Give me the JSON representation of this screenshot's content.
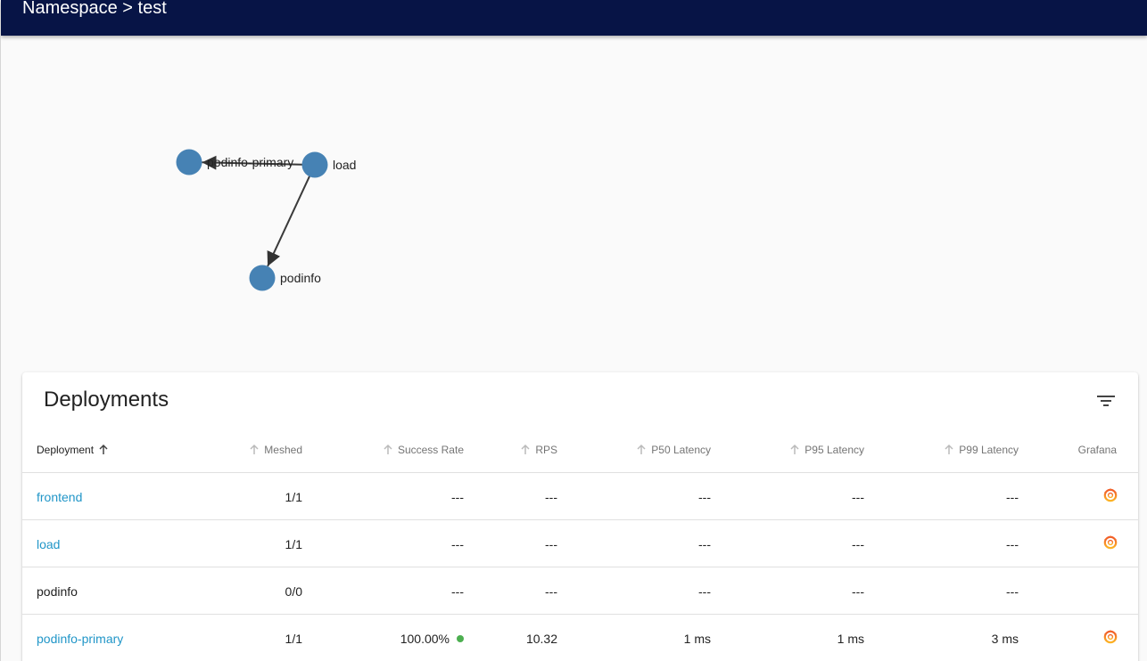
{
  "header": {
    "title": "Namespace > test"
  },
  "graph": {
    "nodes": [
      {
        "id": "podinfo-primary",
        "label": "podinfo-primary"
      },
      {
        "id": "load",
        "label": "load"
      },
      {
        "id": "podinfo",
        "label": "podinfo"
      }
    ],
    "edges": [
      {
        "from": "load",
        "to": "podinfo-primary"
      },
      {
        "from": "load",
        "to": "podinfo"
      }
    ],
    "node_color": "#4682b4"
  },
  "deployments": {
    "title": "Deployments",
    "filter_icon": "filter-list-icon",
    "columns": [
      "Deployment",
      "Meshed",
      "Success Rate",
      "RPS",
      "P50 Latency",
      "P95 Latency",
      "P99 Latency",
      "Grafana"
    ],
    "rows": [
      {
        "name": "frontend",
        "link": true,
        "meshed": "1/1",
        "success": "---",
        "rps": "---",
        "p50": "---",
        "p95": "---",
        "p99": "---",
        "grafana": true
      },
      {
        "name": "load",
        "link": true,
        "meshed": "1/1",
        "success": "---",
        "rps": "---",
        "p50": "---",
        "p95": "---",
        "p99": "---",
        "grafana": true
      },
      {
        "name": "podinfo",
        "link": false,
        "meshed": "0/0",
        "success": "---",
        "rps": "---",
        "p50": "---",
        "p95": "---",
        "p99": "---",
        "grafana": false
      },
      {
        "name": "podinfo-primary",
        "link": true,
        "meshed": "1/1",
        "success": "100.00%",
        "success_status": "good",
        "rps": "10.32",
        "p50": "1 ms",
        "p95": "1 ms",
        "p99": "3 ms",
        "grafana": true
      }
    ]
  },
  "colors": {
    "header_bg": "#071446",
    "link": "#2196c8",
    "success_dot": "#4caf50"
  }
}
